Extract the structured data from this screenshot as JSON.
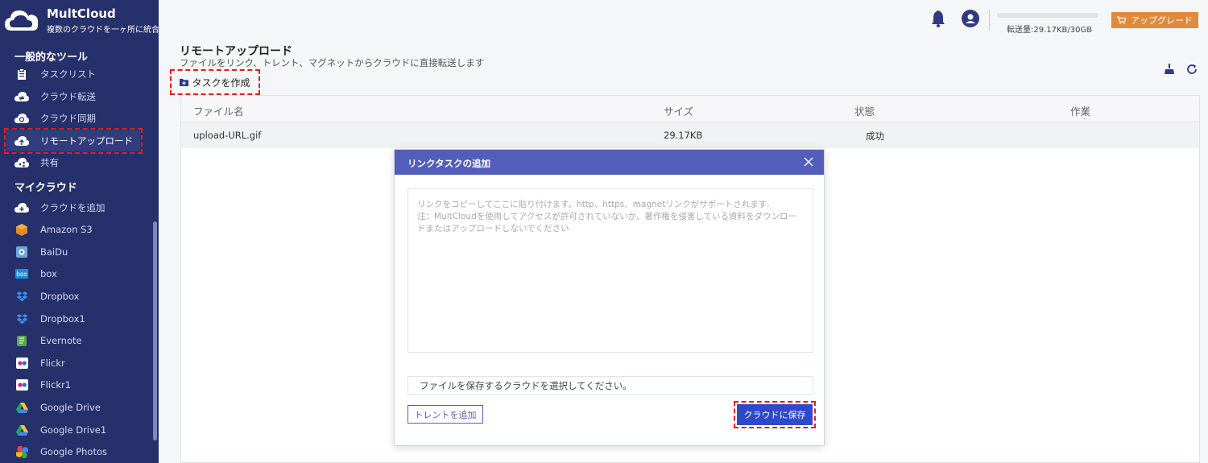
{
  "app": {
    "name": "MultCloud",
    "tagline": "複数のクラウドを一ヶ所に統合"
  },
  "sidebar": {
    "tools_title": "一般的なツール",
    "tools": [
      {
        "label": "タスクリスト",
        "icon": "clipboard-icon"
      },
      {
        "label": "クラウド転送",
        "icon": "cloud-transfer-icon"
      },
      {
        "label": "クラウド同期",
        "icon": "cloud-sync-icon"
      },
      {
        "label": "リモートアップロード",
        "icon": "cloud-upload-icon",
        "active": true
      },
      {
        "label": "共有",
        "icon": "cloud-share-icon"
      }
    ],
    "clouds_title": "マイクラウド",
    "clouds": [
      {
        "label": "クラウドを追加",
        "icon": "cloud-add-icon"
      },
      {
        "label": "Amazon S3",
        "icon": "amazon-s3-icon"
      },
      {
        "label": "BaiDu",
        "icon": "baidu-icon"
      },
      {
        "label": "box",
        "icon": "box-icon"
      },
      {
        "label": "Dropbox",
        "icon": "dropbox-icon"
      },
      {
        "label": "Dropbox1",
        "icon": "dropbox-icon"
      },
      {
        "label": "Evernote",
        "icon": "evernote-icon"
      },
      {
        "label": "Flickr",
        "icon": "flickr-icon"
      },
      {
        "label": "Flickr1",
        "icon": "flickr-icon"
      },
      {
        "label": "Google Drive",
        "icon": "google-drive-icon"
      },
      {
        "label": "Google Drive1",
        "icon": "google-drive-icon"
      },
      {
        "label": "Google Photos",
        "icon": "google-photos-icon"
      }
    ]
  },
  "topbar": {
    "transfer_text": "転送量:29.17KB/30GB",
    "upgrade_label": "アップグレード"
  },
  "page": {
    "title": "リモートアップロード",
    "subtitle": "ファイルをリンク、トレント、マグネットからクラウドに直接転送します",
    "create_task_label": "タスクを作成"
  },
  "table": {
    "headers": {
      "name": "ファイル名",
      "size": "サイズ",
      "status": "状態",
      "action": "作業"
    },
    "rows": [
      {
        "name": "upload-URL.gif",
        "size": "29.17KB",
        "status": "成功"
      }
    ]
  },
  "modal": {
    "title": "リンクタスクの追加",
    "textarea_placeholder": "リンクをコピーしてここに貼り付けます。http、https、magnetリンクがサポートされます.\n注：MultCloudを使用してアクセスが許可されていないか、著作権を侵害している資料をダウンロードまたはアップロードしないでください",
    "select_label": "ファイルを保存するクラウドを選択してください。",
    "torrent_label": "トレントを追加",
    "save_label": "クラウドに保存"
  },
  "colors": {
    "sidebar_bg": "#26306b",
    "modal_header": "#525eb8",
    "primary_button": "#2f49c9",
    "upgrade_button": "#e08a3c",
    "highlight_dash": "#e01f1f"
  }
}
